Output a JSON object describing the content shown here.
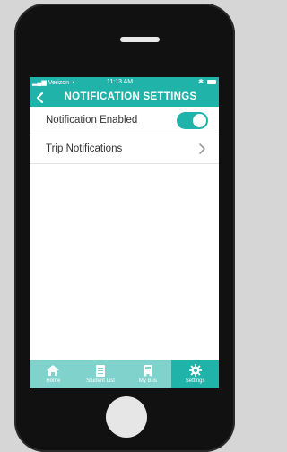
{
  "status": {
    "carrier": "Verizon",
    "time": "11:13 AM"
  },
  "header": {
    "title": "NOTIFICATION SETTINGS",
    "back_icon": "chevron-left-icon"
  },
  "settings": [
    {
      "label": "Notification Enabled",
      "control": "toggle",
      "enabled": true
    },
    {
      "label": "Trip Notifications",
      "control": "chevron"
    }
  ],
  "tabs": [
    {
      "label": "Home",
      "icon": "home-icon",
      "active": false
    },
    {
      "label": "Student List",
      "icon": "clipboard-icon",
      "active": false
    },
    {
      "label": "My Bus",
      "icon": "bus-icon",
      "active": false
    },
    {
      "label": "Settings",
      "icon": "gear-icon",
      "active": true
    }
  ],
  "colors": {
    "accent": "#1fb3aa",
    "tabbar_inactive": "#7fd3cc"
  }
}
